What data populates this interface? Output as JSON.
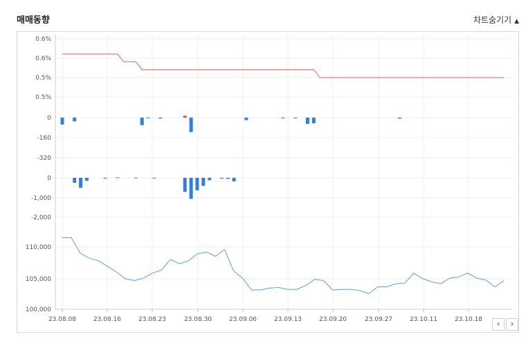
{
  "header": {
    "title": "매매동향",
    "toggle_label": "차트숨기기",
    "toggle_icon": "▲"
  },
  "nav": {
    "prev": "‹",
    "next": "›"
  },
  "chart_data": [
    {
      "type": "line",
      "name": "ratio",
      "color": "#f05a5a",
      "ytick_labels": [
        "0.6%",
        "0.6%",
        "0.5%",
        "0.5%"
      ],
      "ylim": [
        0.5,
        0.62
      ],
      "values": [
        0.6,
        0.6,
        0.6,
        0.6,
        0.6,
        0.6,
        0.6,
        0.6,
        0.6,
        0.6,
        0.58,
        0.58,
        0.58,
        0.56,
        0.56,
        0.56,
        0.56,
        0.56,
        0.56,
        0.56,
        0.56,
        0.56,
        0.56,
        0.56,
        0.56,
        0.56,
        0.56,
        0.56,
        0.56,
        0.56,
        0.56,
        0.56,
        0.56,
        0.56,
        0.56,
        0.56,
        0.56,
        0.56,
        0.56,
        0.56,
        0.56,
        0.56,
        0.54,
        0.54,
        0.54,
        0.54,
        0.54,
        0.54,
        0.54,
        0.54,
        0.54,
        0.54,
        0.54,
        0.54,
        0.54,
        0.54,
        0.54,
        0.54,
        0.54,
        0.54,
        0.54,
        0.54,
        0.54,
        0.54,
        0.54,
        0.54,
        0.54,
        0.54,
        0.54,
        0.54,
        0.54,
        0.54,
        0.54
      ]
    },
    {
      "type": "bar",
      "name": "bar1",
      "ytick_labels": [
        "0",
        "-160",
        "-320"
      ],
      "ylim": [
        -400,
        40
      ],
      "pos_color": "#f04040",
      "neg_color": "#2f7fe0",
      "values": [
        -55,
        0,
        -30,
        0,
        0,
        0,
        0,
        0,
        0,
        0,
        0,
        0,
        0,
        -60,
        -5,
        0,
        -8,
        0,
        0,
        0,
        15,
        -115,
        0,
        0,
        0,
        0,
        0,
        0,
        0,
        0,
        -20,
        0,
        0,
        0,
        0,
        0,
        -3,
        0,
        -3,
        0,
        -50,
        -45,
        0,
        0,
        0,
        0,
        0,
        0,
        0,
        0,
        0,
        0,
        0,
        0,
        0,
        -8,
        0,
        0,
        0,
        0,
        0,
        0,
        0,
        0,
        0,
        0,
        0,
        0,
        0,
        0,
        0,
        0,
        0
      ]
    },
    {
      "type": "bar",
      "name": "bar2",
      "ytick_labels": [
        "0",
        "-1,000",
        "-2,000"
      ],
      "ylim": [
        -2200,
        200
      ],
      "pos_color": "#f04040",
      "neg_color": "#2f7fe0",
      "values": [
        0,
        0,
        -250,
        -500,
        -150,
        0,
        0,
        -40,
        0,
        20,
        0,
        0,
        15,
        0,
        0,
        -20,
        0,
        0,
        0,
        0,
        -700,
        -1050,
        -620,
        -400,
        -120,
        0,
        -40,
        -50,
        -180,
        0,
        0,
        0,
        0,
        0,
        0,
        0,
        0,
        0,
        0,
        0,
        0,
        0,
        0,
        0,
        0,
        0,
        0,
        0,
        0,
        0,
        0,
        0,
        0,
        0,
        0,
        0,
        0,
        0,
        0,
        0,
        0,
        0,
        0,
        0,
        0,
        0,
        0,
        0,
        0,
        0,
        0,
        0,
        0
      ]
    },
    {
      "type": "line",
      "name": "price",
      "color": "#5aa0e6",
      "ytick_labels": [
        "110,000",
        "105,000",
        "100,000"
      ],
      "ylim": [
        100000,
        110000
      ],
      "xtick_labels": [
        "23.08.08",
        "23.08.16",
        "23.08.23",
        "23.08.30",
        "23.09.06",
        "23.09.13",
        "23.09.20",
        "23.09.27",
        "23.10.11",
        "23.10.18"
      ],
      "values": [
        111500,
        111500,
        109000,
        108200,
        107800,
        106900,
        106000,
        104900,
        104600,
        105000,
        105800,
        106300,
        108000,
        107300,
        107800,
        108900,
        109200,
        108500,
        109600,
        106200,
        105000,
        103100,
        103100,
        103400,
        103500,
        103200,
        103200,
        103800,
        104800,
        104600,
        103100,
        103200,
        103200,
        103000,
        102500,
        103600,
        103600,
        104100,
        104200,
        105800,
        104900,
        104400,
        104100,
        105000,
        105200,
        105800,
        105000,
        104700,
        103600,
        104600
      ]
    }
  ]
}
